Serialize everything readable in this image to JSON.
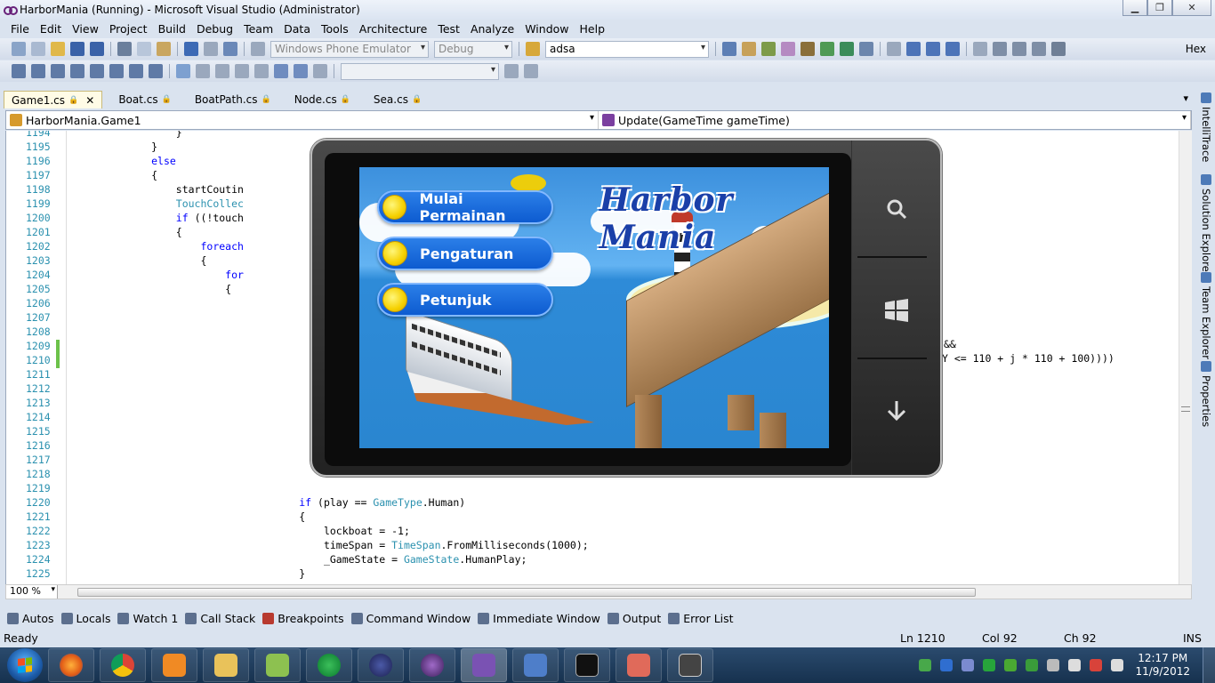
{
  "window": {
    "title": "HarborMania (Running) - Microsoft Visual Studio (Administrator)"
  },
  "menu": [
    "File",
    "Edit",
    "View",
    "Project",
    "Build",
    "Debug",
    "Team",
    "Data",
    "Tools",
    "Architecture",
    "Test",
    "Analyze",
    "Window",
    "Help"
  ],
  "toolbar": {
    "target_device": "Windows Phone Emulator",
    "configuration": "Debug",
    "find_text": "adsa",
    "hex_label": "Hex"
  },
  "tabs": [
    {
      "label": "Game1.cs",
      "active": true
    },
    {
      "label": "Boat.cs",
      "active": false
    },
    {
      "label": "BoatPath.cs",
      "active": false
    },
    {
      "label": "Node.cs",
      "active": false
    },
    {
      "label": "Sea.cs",
      "active": false
    }
  ],
  "nav": {
    "type_combo": "HarborMania.Game1",
    "member_combo": "Update(GameTime gameTime)"
  },
  "code_lines": [
    {
      "n": "1194",
      "text": "                }"
    },
    {
      "n": "1195",
      "text": "            }"
    },
    {
      "n": "1196",
      "text": "            else"
    },
    {
      "n": "1197",
      "text": "            {"
    },
    {
      "n": "1198",
      "text": "                startCoutin"
    },
    {
      "n": "1199",
      "text": "                TouchCollec"
    },
    {
      "n": "1200",
      "text": "                if ((!touch"
    },
    {
      "n": "1201",
      "text": "                {"
    },
    {
      "n": "1202",
      "text": "                    foreach"
    },
    {
      "n": "1203",
      "text": "                    {"
    },
    {
      "n": "1204",
      "text": "                        for"
    },
    {
      "n": "1205",
      "text": "                        {"
    },
    {
      "n": "1206",
      "text": ""
    },
    {
      "n": "1207",
      "text": ""
    },
    {
      "n": "1208",
      "text": ""
    },
    {
      "n": "1209",
      "text": ""
    },
    {
      "n": "1210",
      "text": ""
    },
    {
      "n": "1211",
      "text": ""
    },
    {
      "n": "1212",
      "text": ""
    },
    {
      "n": "1213",
      "text": ""
    },
    {
      "n": "1214",
      "text": ""
    },
    {
      "n": "1215",
      "text": ""
    },
    {
      "n": "1216",
      "text": ""
    },
    {
      "n": "1217",
      "text": ""
    },
    {
      "n": "1218",
      "text": ""
    },
    {
      "n": "1219",
      "text": ""
    },
    {
      "n": "1220",
      "text": "                                    if (play == GameType.Human)"
    },
    {
      "n": "1221",
      "text": "                                    {"
    },
    {
      "n": "1222",
      "text": "                                        lockboat = -1;"
    },
    {
      "n": "1223",
      "text": "                                        timeSpan = TimeSpan.FromMilliseconds(1000);"
    },
    {
      "n": "1224",
      "text": "                                        _GameState = GameState.HumanPlay;"
    },
    {
      "n": "1225",
      "text": "                                    }"
    }
  ],
  "code_fragments": {
    "line_1209_tail": "&&",
    "line_1210_tail": "Y <= 110 + j * 110 + 100))))"
  },
  "editor_strip": {
    "zoom": "100 %"
  },
  "side_tabs": [
    "IntelliTrace",
    "Solution Explorer",
    "Team Explorer",
    "Properties"
  ],
  "tool_tabs": [
    "Autos",
    "Locals",
    "Watch 1",
    "Call Stack",
    "Breakpoints",
    "Command Window",
    "Immediate Window",
    "Output",
    "Error List"
  ],
  "status": {
    "text": "Ready",
    "ln": "Ln 1210",
    "col": "Col 92",
    "ch": "Ch 92",
    "mode": "INS"
  },
  "emulator": {
    "game_title": "Harbor Mania",
    "menu_buttons": [
      "Mulai Permainan",
      "Pengaturan",
      "Petunjuk"
    ]
  },
  "taskbar": {
    "time": "12:17 PM",
    "date": "11/9/2012"
  },
  "colors": {
    "keyword": "#0000ff",
    "type": "#2b91af",
    "line_number": "#2b91af",
    "change_bar": "#6cc24a"
  }
}
